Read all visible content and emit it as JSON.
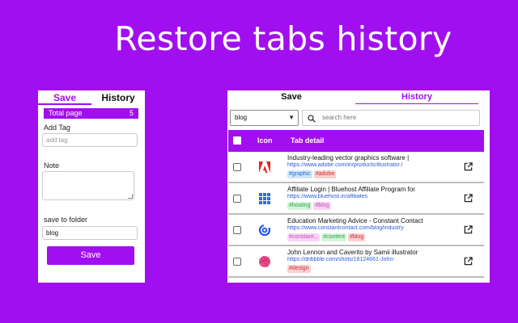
{
  "headline": "Restore tabs history",
  "colors": {
    "background": "#a10ff0",
    "accent": "#a10ff0",
    "link": "#2a5bd7"
  },
  "left_panel": {
    "tabs": [
      {
        "label": "Save",
        "active": true
      },
      {
        "label": "History",
        "active": false
      }
    ],
    "total": {
      "label": "Total page",
      "count": "5"
    },
    "add_tag": {
      "label": "Add Tag",
      "placeholder": "add tag"
    },
    "note": {
      "label": "Note"
    },
    "folder": {
      "label": "save to folder",
      "value": "blog"
    },
    "save_button": "Save"
  },
  "right_panel": {
    "tabs": [
      {
        "label": "Save",
        "active": false
      },
      {
        "label": "History",
        "active": true
      }
    ],
    "folder_select": "blog",
    "search_placeholder": "search here",
    "columns": {
      "icon": "Icon",
      "detail": "Tab detail"
    },
    "rows": [
      {
        "icon": "adobe-icon",
        "title": "Industry-leading vector graphics software |",
        "url": "https://www.adobe.com/in/products/illustrator.l",
        "tags": [
          {
            "text": "#graphic",
            "color": "blue"
          },
          {
            "text": "#adobe",
            "color": "red"
          }
        ]
      },
      {
        "icon": "bluehost-icon",
        "title": "Affiliate Login | Bluehost Affiliate Program for",
        "url": "https://www.bluehost.in/affiliates",
        "tags": [
          {
            "text": "#hosting",
            "color": "green"
          },
          {
            "text": "#blog",
            "color": "pink"
          }
        ]
      },
      {
        "icon": "constant-contact-icon",
        "title": "Education Marketing Advice - Constant Contact",
        "url": "https://www.constantcontact.com/blog/industry",
        "tags": [
          {
            "text": "#constant...",
            "color": "pink"
          },
          {
            "text": "#content",
            "color": "green"
          },
          {
            "text": "#blog",
            "color": "red"
          }
        ]
      },
      {
        "icon": "dribbble-icon",
        "title": "John Lennon and Caverito by Samii illustrator",
        "url": "https://dribbble.com/shots/18124661-John-",
        "tags": [
          {
            "text": "#design",
            "color": "red"
          }
        ]
      }
    ]
  }
}
